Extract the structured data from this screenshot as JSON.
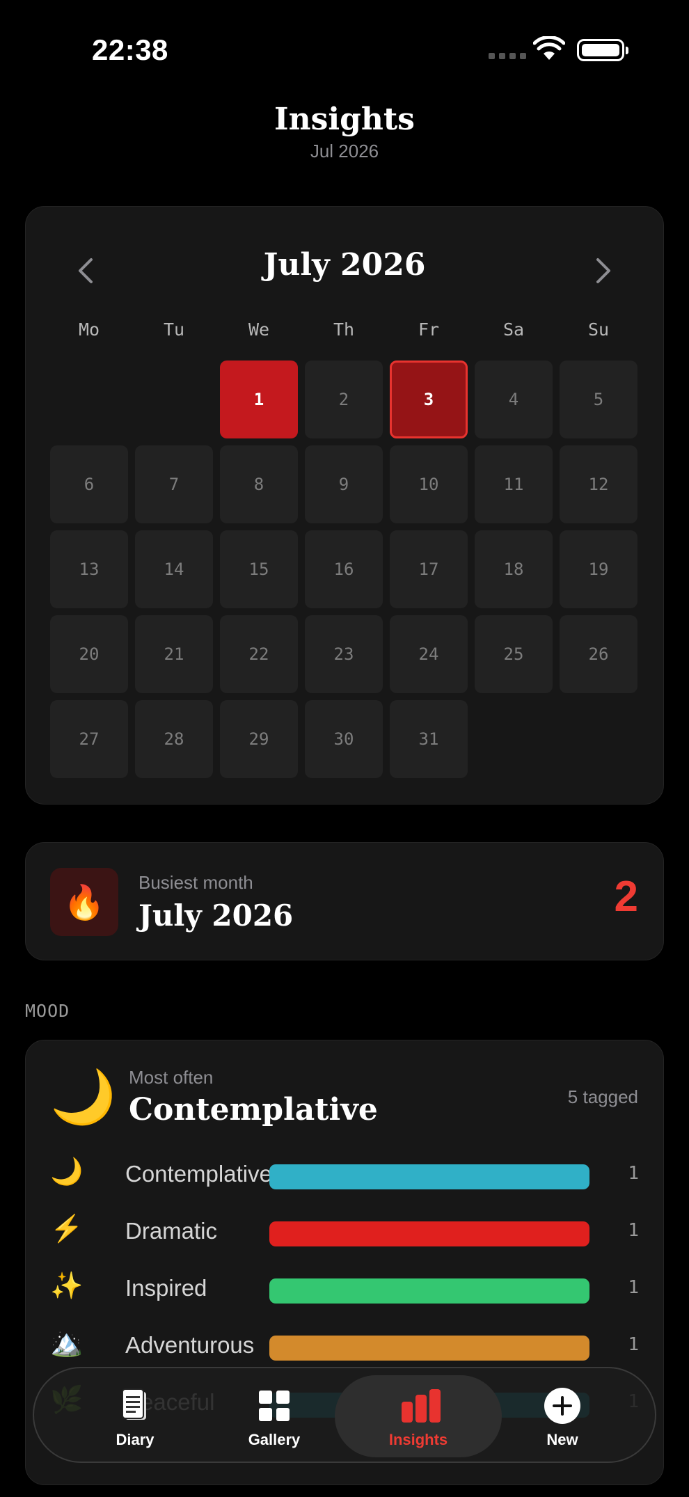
{
  "status_bar": {
    "time": "22:38"
  },
  "header": {
    "title": "Insights",
    "subtitle": "Jul 2026"
  },
  "calendar": {
    "month_title": "July 2026",
    "weekdays": [
      "Mo",
      "Tu",
      "We",
      "Th",
      "Fr",
      "Sa",
      "Su"
    ],
    "leading_blanks": 2,
    "days": [
      "1",
      "2",
      "3",
      "4",
      "5",
      "6",
      "7",
      "8",
      "9",
      "10",
      "11",
      "12",
      "13",
      "14",
      "15",
      "16",
      "17",
      "18",
      "19",
      "20",
      "21",
      "22",
      "23",
      "24",
      "25",
      "26",
      "27",
      "28",
      "29",
      "30",
      "31"
    ],
    "entry_days": [
      "1",
      "3"
    ],
    "today": "3"
  },
  "busiest": {
    "label": "Busiest month",
    "value": "July 2026",
    "count": "2"
  },
  "mood_section_label": "MOOD",
  "mood": {
    "most_label": "Most often",
    "most_value": "Contemplative",
    "tagged": "5 tagged",
    "rows": [
      {
        "icon": "🌙",
        "icon_name": "moon-icon",
        "label": "Contemplative",
        "count": "1",
        "fraction": 1.0,
        "color": "#30b0c7"
      },
      {
        "icon": "⚡",
        "icon_name": "lightning-icon",
        "label": "Dramatic",
        "count": "1",
        "fraction": 1.0,
        "color": "#e0201e"
      },
      {
        "icon": "✨",
        "icon_name": "sparkles-icon",
        "label": "Inspired",
        "count": "1",
        "fraction": 1.0,
        "color": "#34c771"
      },
      {
        "icon": "🏔️",
        "icon_name": "mountain-icon",
        "label": "Adventurous",
        "count": "1",
        "fraction": 1.0,
        "color": "#d38a2c"
      },
      {
        "icon": "🌿",
        "icon_name": "leaf-icon",
        "label": "Peaceful",
        "count": "1",
        "fraction": 1.0,
        "color": "#0a8a9a"
      }
    ]
  },
  "busiest_icon": "🔥",
  "mood_icon": "🌙",
  "tabs": [
    {
      "label": "Diary",
      "icon": "diary-icon",
      "active": false
    },
    {
      "label": "Gallery",
      "icon": "gallery-icon",
      "active": false
    },
    {
      "label": "Insights",
      "icon": "insights-icon",
      "active": true
    },
    {
      "label": "New",
      "icon": "plus-icon",
      "active": false
    }
  ],
  "colors": {
    "accent": "#ef3b33",
    "entry_day": "#c4191e",
    "today_day": "#951416"
  }
}
